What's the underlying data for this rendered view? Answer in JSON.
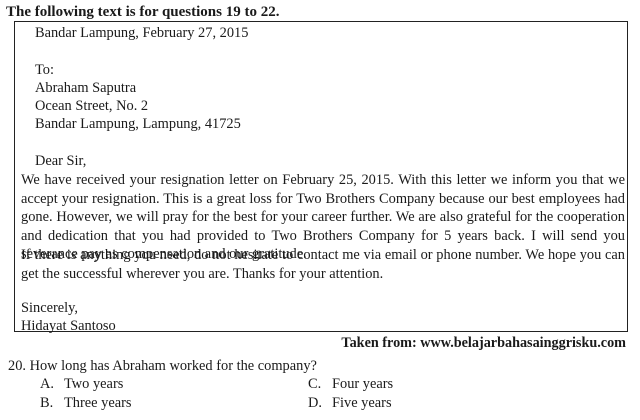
{
  "heading": "The following text is for questions 19 to 22.",
  "letter": {
    "date_line": "Bandar Lampung, February 27, 2015",
    "to_label": "To:",
    "recipient_name": "Abraham Saputra",
    "recipient_street": "Ocean Street, No. 2",
    "recipient_city": "Bandar Lampung, Lampung, 41725",
    "salutation": "Dear Sir,",
    "paragraph_1": "We have received your resignation letter on February 25, 2015. With this letter we inform you that we accept your resignation. This is a great loss for Two Brothers Company because our best employees had gone. However, we will pray for the best for your career further. We are also grateful for the cooperation and dedication that you had provided to Two Brothers Company for 5 years back. I will send you severance pay as compensation and our gratitude.",
    "paragraph_2": "If there is anything you need, do not hesitate to contact me via email or phone number. We hope you can get the successful wherever you are. Thanks for your attention.",
    "closing": "Sincerely,",
    "signature": "Hidayat Santoso"
  },
  "source": "Taken from: www.belajarbahasainggrisku.com",
  "question": {
    "text": "20.  How long has Abraham worked for the company?",
    "options": [
      {
        "letter": "A.",
        "text": "Two years"
      },
      {
        "letter": "B.",
        "text": "Three years"
      },
      {
        "letter": "C.",
        "text": "Four years"
      },
      {
        "letter": "D.",
        "text": "Five years"
      }
    ]
  }
}
